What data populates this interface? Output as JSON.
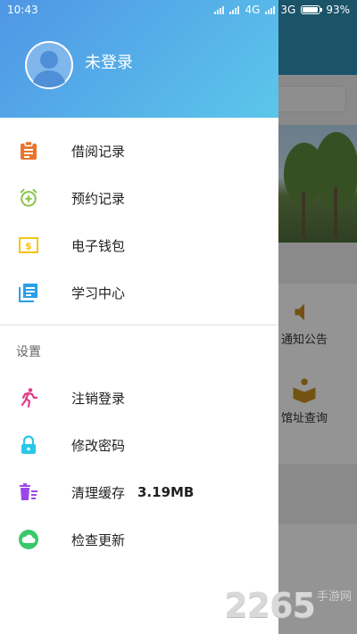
{
  "status_bar": {
    "time": "10:43",
    "network": "4G",
    "network2": "3G",
    "battery": "93%",
    "battery_level": 0.93
  },
  "drawer": {
    "login_label": "未登录",
    "menu": [
      {
        "label": "借阅记录",
        "icon": "clipboard-icon",
        "color": "#e8752b"
      },
      {
        "label": "预约记录",
        "icon": "alarm-add-icon",
        "color": "#8bc34a"
      },
      {
        "label": "电子钱包",
        "icon": "wallet-icon",
        "color": "#f5c518"
      },
      {
        "label": "学习中心",
        "icon": "library-books-icon",
        "color": "#2a9fe8"
      }
    ],
    "settings_title": "设置",
    "settings": [
      {
        "label": "注销登录",
        "icon": "running-man-icon",
        "color": "#e23c8a"
      },
      {
        "label": "修改密码",
        "icon": "lock-icon",
        "color": "#28c8e8"
      },
      {
        "label": "清理缓存",
        "icon": "trash-icon",
        "color": "#9b47e8",
        "value": "3.19MB"
      },
      {
        "label": "检查更新",
        "icon": "cloud-icon",
        "color": "#38c96a"
      }
    ]
  },
  "background": {
    "items": [
      {
        "label": "通知公告",
        "icon": "speaker-icon"
      },
      {
        "label": "馆址查询",
        "icon": "book-reader-icon"
      }
    ]
  },
  "watermark": {
    "number": "2265",
    "text": "手游网"
  }
}
